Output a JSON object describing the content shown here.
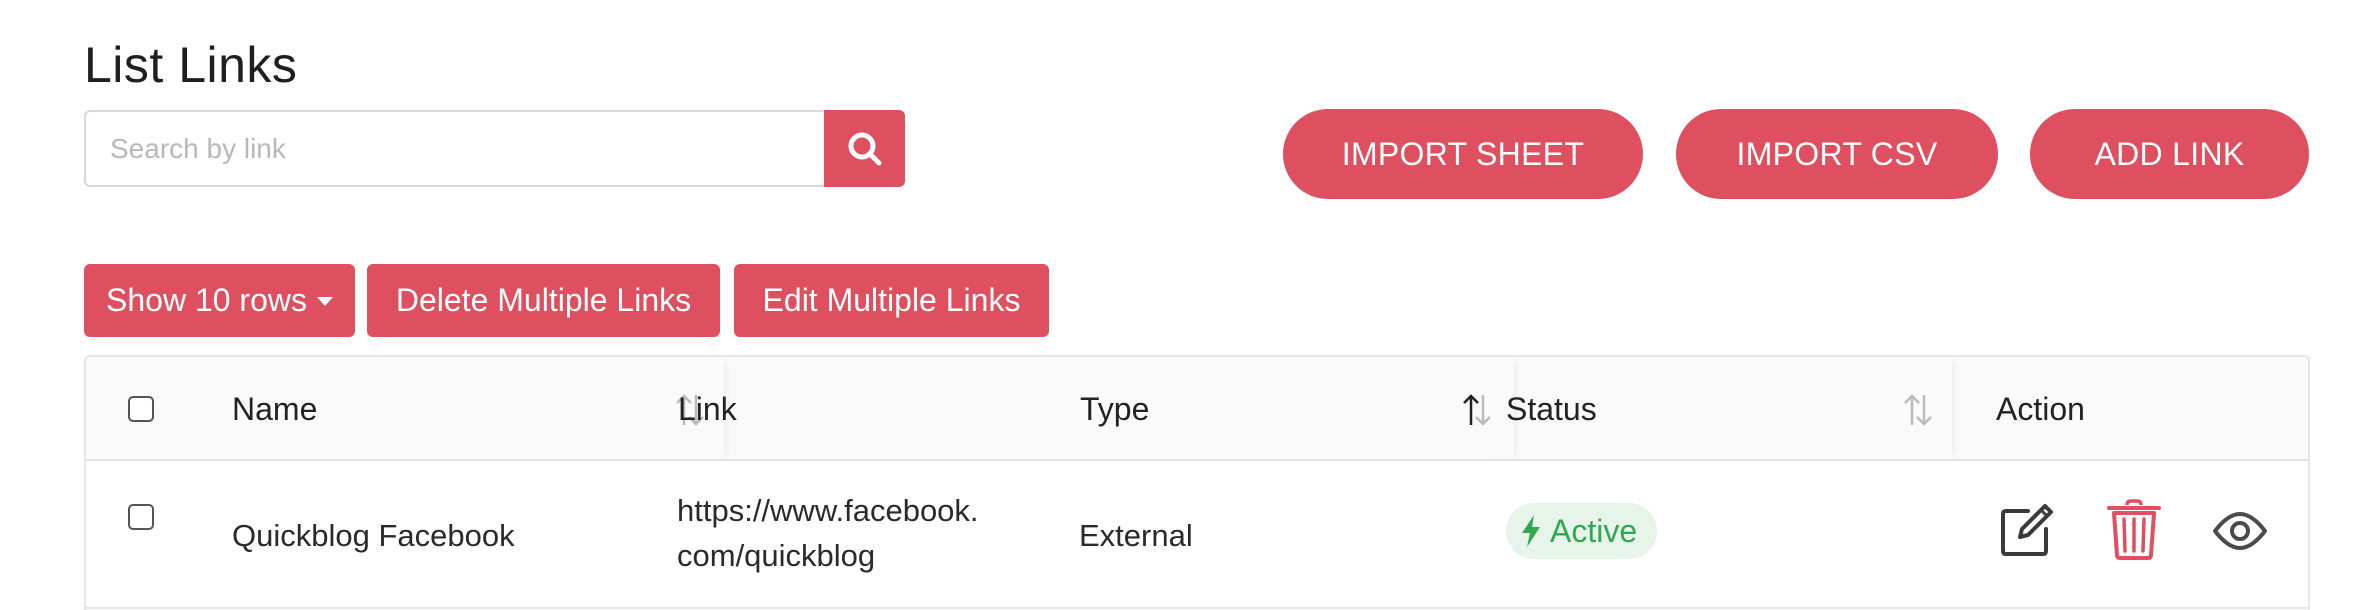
{
  "header": {
    "title": "List Links"
  },
  "search": {
    "placeholder": "Search by link",
    "value": "",
    "button_icon": "search-icon"
  },
  "top_buttons": {
    "import_sheet": "IMPORT SHEET",
    "import_csv": "IMPORT CSV",
    "add_link": "ADD LINK"
  },
  "toolbar": {
    "show_rows": "Show 10 rows",
    "delete_multiple": "Delete Multiple Links",
    "edit_multiple": "Edit Multiple Links"
  },
  "table": {
    "columns": [
      {
        "label": "Name",
        "sortable": true,
        "sort": "none"
      },
      {
        "label": "Link",
        "sortable": false
      },
      {
        "label": "Type",
        "sortable": true,
        "sort": "ascending"
      },
      {
        "label": "Status",
        "sortable": true,
        "sort": "none"
      },
      {
        "label": "Action",
        "sortable": false
      }
    ],
    "rows": [
      {
        "selected": false,
        "name": "Quickblog Facebook",
        "link_line1": "https://www.facebook.",
        "link_line2": "com/quickblog",
        "type": "External",
        "status": "Active",
        "actions": [
          "edit-icon",
          "trash-icon",
          "eye-icon"
        ]
      }
    ]
  },
  "colors": {
    "accent": "#de4f5f",
    "status_active_bg": "#e6f4ea",
    "status_active_text": "#2fa84f",
    "header_bg": "#fafafa"
  }
}
